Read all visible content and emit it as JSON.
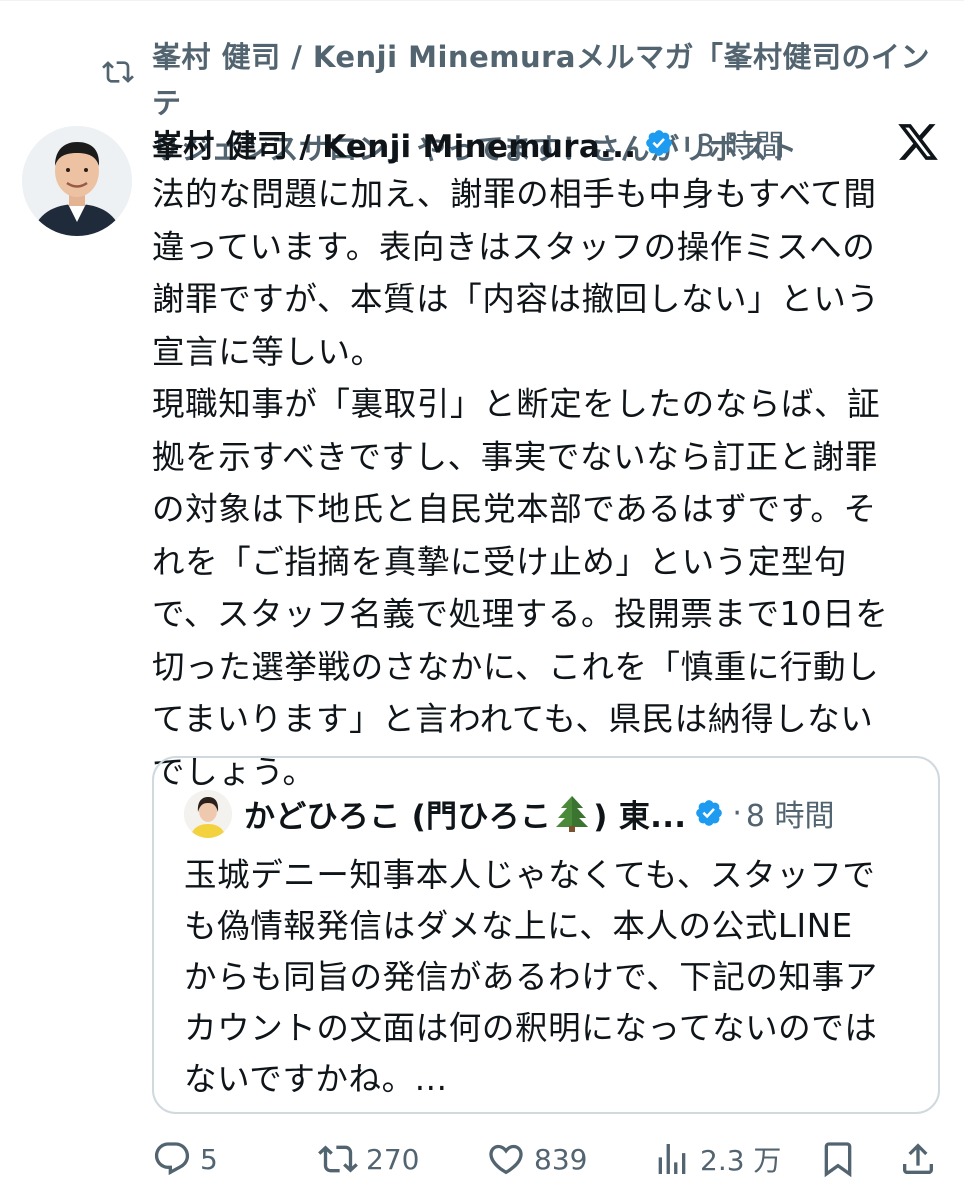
{
  "repost": {
    "lines": [
      "峯村 健司 / Kenji Minemuraメルマガ「峯村健司のインテ",
      "リジェンスサロン」やってます！さんがリポスト"
    ],
    "icon": "repost-icon"
  },
  "post": {
    "author_name": "峯村 健司 / Kenji Minemura...",
    "verified": true,
    "separator": "·",
    "time": "3 時間",
    "platform_icon": "x-logo-icon",
    "lines": [
      "法的な問題に加え、謝罪の相手も中身もすべて間",
      "違っています。表向きはスタッフの操作ミスへの",
      "謝罪ですが、本質は「内容は撤回しない」という",
      "宣言に等しい。",
      "現職知事が「裏取引」と断定をしたのならば、証",
      "拠を示すべきですし、事実でないなら訂正と謝罪",
      "の対象は下地氏と自民党本部であるはずです。そ",
      "れを「ご指摘を真摯に受け止め」という定型句",
      "で、スタッフ名義で処理する。投開票まで10日を",
      "切った選挙戦のさなかに、これを「慎重に行動し",
      "てまいります」と言われても、県民は納得しない",
      "でしょう。"
    ]
  },
  "quote": {
    "author_name_prefix": "かどひろこ (門ひろこ",
    "author_name_suffix": ") 東...",
    "tree_icon": "evergreen-tree-icon",
    "verified": true,
    "separator": "·",
    "time": "8 時間",
    "lines": [
      "玉城デニー知事本人じゃなくても、スタッフで",
      "も偽情報発信はダメな上に、本人の公式LINE",
      "からも同旨の発信があるわけで、下記の知事ア",
      "カウントの文面は何の釈明になってないのでは",
      "ないですかね。..."
    ]
  },
  "actions": {
    "reply_count": "5",
    "repost_count": "270",
    "like_count": "839",
    "views_count": "2.3 万",
    "bookmark_icon": "bookmark-icon",
    "share_icon": "share-icon"
  },
  "colors": {
    "text": "#0f1419",
    "muted": "#536471",
    "verified": "#1d9bf0",
    "border": "#cfd9de"
  }
}
